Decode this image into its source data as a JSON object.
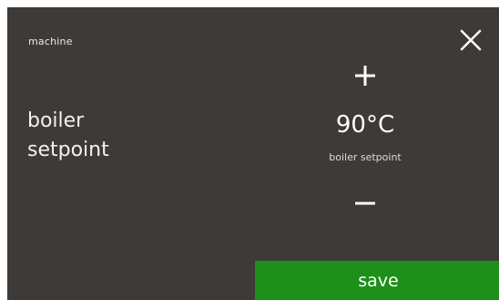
{
  "header": {
    "breadcrumb": "machine",
    "close_icon": "close-icon"
  },
  "parameter": {
    "label_line1": "boiler",
    "label_line2": "setpoint",
    "value": "90°C",
    "caption": "boiler setpoint",
    "increase_icon": "plus-icon",
    "decrease_icon": "minus-icon"
  },
  "actions": {
    "save_label": "save"
  },
  "colors": {
    "background": "#3d3a37",
    "save_button": "#1e8f1b",
    "text": "#ffffff"
  }
}
